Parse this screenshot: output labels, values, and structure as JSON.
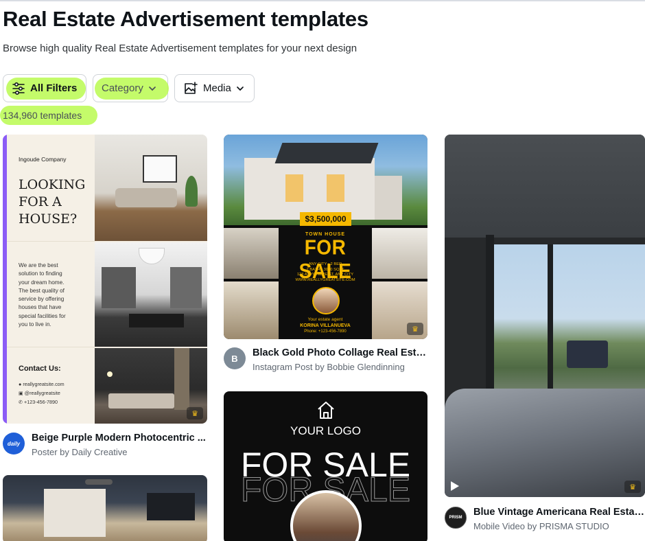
{
  "page": {
    "title": "Real Estate Advertisement templates",
    "subtitle": "Browse high quality Real Estate Advertisement templates for your next design",
    "result_count": "134,960 templates"
  },
  "filters": {
    "all_filters": "All Filters",
    "category": "Category",
    "media": "Media"
  },
  "highlight_color": "#bafa50",
  "templates": [
    {
      "title": "Beige Purple Modern Photocentric ...",
      "subtitle": "Poster by Daily Creative",
      "avatar_text": "daily",
      "avatar_color": "#1f5fd8",
      "preview": {
        "company": "Ingoude Company",
        "headline": [
          "LOOKING",
          "FOR A",
          "HOUSE?"
        ],
        "body": [
          "We are the best",
          "solution to finding",
          "your dream home.",
          "The best quality of",
          "service by offering",
          "houses that have",
          "special facilities for",
          "you to live in."
        ],
        "contact_title": "Contact Us:",
        "contacts": [
          "reallygreatsite.com",
          "@reallygreatsite",
          "+123-456-7890"
        ],
        "accent_color": "#8b5cf6"
      }
    },
    {
      "title": "Black Gold Photo Collage Real Esta...",
      "subtitle": "Instagram Post by Bobbie Glendinning",
      "avatar_text": "B",
      "avatar_color": "#7d8a96",
      "preview": {
        "price": "$3,500,000",
        "kicker": "TOWN HOUSE",
        "headline": "FOR SALE",
        "details": [
          "ANY CITY • 2 BED",
          "2 BATH • 3060 SQFT",
          "123 ANYWHERE ST, ANY CITY",
          "WWW.REALLYGREATSITE.COM"
        ],
        "agent_label": "Your estate agent",
        "agent_name": "KORINA VILLANUEVA",
        "agent_phone": "Phone: +123-456-7890",
        "accent_color": "#f5b800"
      }
    },
    {
      "title": "Blue Vintage Americana Real Estat...",
      "subtitle": "Mobile Video by PRISMA STUDIO",
      "avatar_text": "PRISM",
      "avatar_color": "#1e1e1e"
    },
    {
      "preview": {
        "logo_text": "YOUR LOGO",
        "headline": "FOR SALE"
      }
    }
  ],
  "icons": {
    "filters": "sliders-icon",
    "category_chevron": "chevron-down-icon",
    "media": "image-add-icon",
    "premium": "crown-icon",
    "video": "play-icon"
  }
}
